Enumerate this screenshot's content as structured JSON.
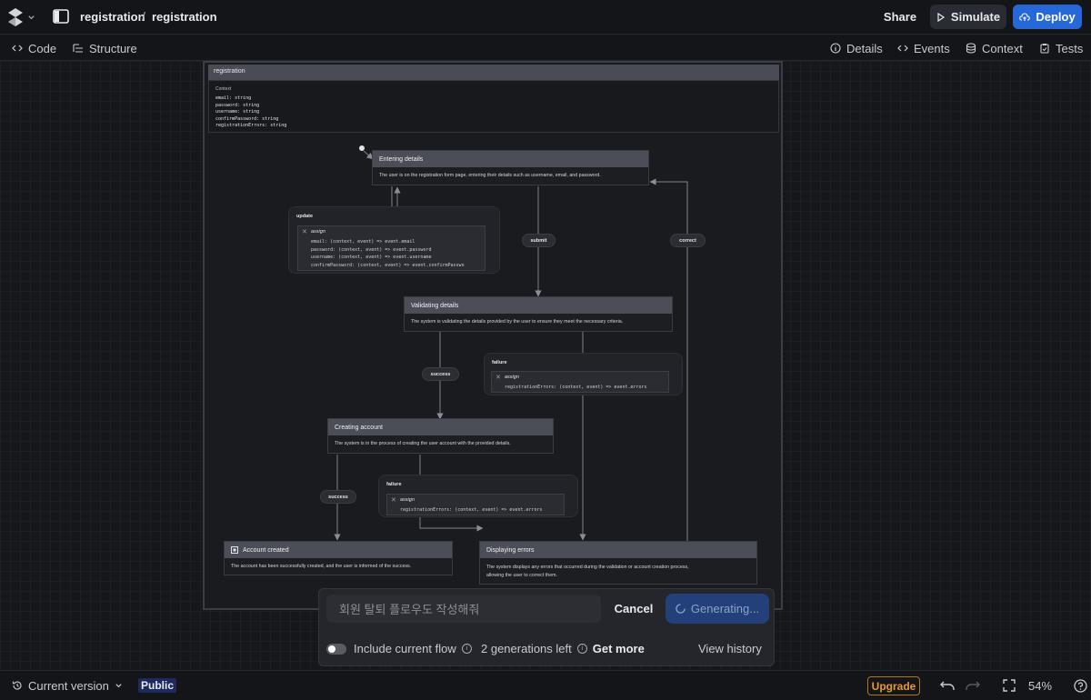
{
  "header": {
    "crumb1": "registration",
    "crumb_sep": "/",
    "crumb2": "registration",
    "share_label": "Share",
    "simulate_label": "Simulate",
    "deploy_label": "Deploy",
    "deploy_color": "#2668d8"
  },
  "tabs": {
    "code": "Code",
    "structure": "Structure",
    "details": "Details",
    "events": "Events",
    "context": "Context",
    "tests": "Tests"
  },
  "machine": {
    "title": "registration",
    "context_label": "Context",
    "context_lines": [
      "email: string",
      "password: string",
      "username: string",
      "confirmPassword: string",
      "registrationErrors: string"
    ]
  },
  "states": {
    "entering": {
      "title": "Entering details",
      "desc": "The user is on the registration form page, entering their details such as username, email, and password."
    },
    "validating": {
      "title": "Validating details",
      "desc": "The system is validating the details provided by the user to ensure they meet the necessary criteria."
    },
    "creating": {
      "title": "Creating account",
      "desc": "The system is in the process of creating the user account with the provided details."
    },
    "created": {
      "title": "Account created",
      "desc": "The account has been successfully created, and the user is informed of the success."
    },
    "errors": {
      "title": "Displaying errors",
      "desc1": "The system displays any errors that occurred during the validation or account creation process,",
      "desc2": "allowing the user to correct them."
    }
  },
  "events": {
    "update": "update",
    "submit": "submit",
    "correct": "correct",
    "success1": "success",
    "failure1": "failure",
    "success2": "success",
    "failure2": "failure"
  },
  "actions": {
    "assign_label": "assign",
    "update_code": "email: (context, event) => event.email\npassword: (context, event) => event.password\nusername: (context, event) => event.username\nconfirmPassword: (context, event) => event.confirmPasswo",
    "failure1_code": "registrationErrors: (context, event) => event.errors",
    "failure2_code": "registrationErrors: (context, event) => event.errors"
  },
  "generator": {
    "input_value": "회원 탈퇴 플로우도 작성해줘",
    "cancel_label": "Cancel",
    "generating_label": "Generating...",
    "include_label": "Include current flow",
    "generations_left": "2 generations left",
    "get_more": "Get more",
    "view_history": "View history"
  },
  "footer": {
    "version_label": "Current version",
    "public_badge": "Public",
    "upgrade_label": "Upgrade",
    "zoom": "54%"
  }
}
